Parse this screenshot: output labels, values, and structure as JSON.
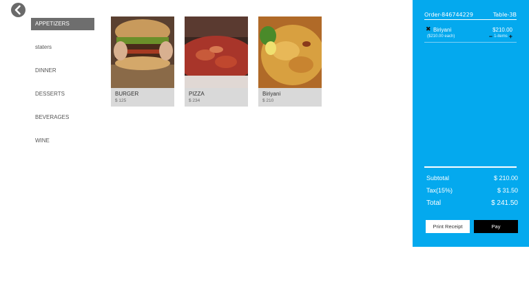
{
  "nav": {
    "back_icon": "chevron-left-icon"
  },
  "categories": [
    {
      "label": "APPETIZERS",
      "active": true
    },
    {
      "label": "staters",
      "active": false
    },
    {
      "label": "DINNER",
      "active": false
    },
    {
      "label": "DESSERTS",
      "active": false
    },
    {
      "label": "BEVERAGES",
      "active": false
    },
    {
      "label": "WINE",
      "active": false
    }
  ],
  "menu_items": [
    {
      "name": "BURGER",
      "price": "$ 125"
    },
    {
      "name": "PIZZA",
      "price": "$ 234"
    },
    {
      "name": "Biriyani",
      "price": "$ 210"
    }
  ],
  "order": {
    "id": "Order-846744229",
    "table": "Table-3B",
    "items": [
      {
        "name": "Biriyani",
        "each": "($210.00 each)",
        "total": "$210.00",
        "qty": "1-items"
      }
    ],
    "subtotal_label": "Subtotal",
    "subtotal": "$ 210.00",
    "tax_label": "Tax(15%)",
    "tax": "$ 31.50",
    "total_label": "Total",
    "total": "$ 241.50",
    "print_label": "Print Receipt",
    "pay_label": "Pay"
  },
  "colors": {
    "panel": "#04a9ee",
    "active_category": "#6e6e6e",
    "card_meta": "#d9d9d9"
  }
}
